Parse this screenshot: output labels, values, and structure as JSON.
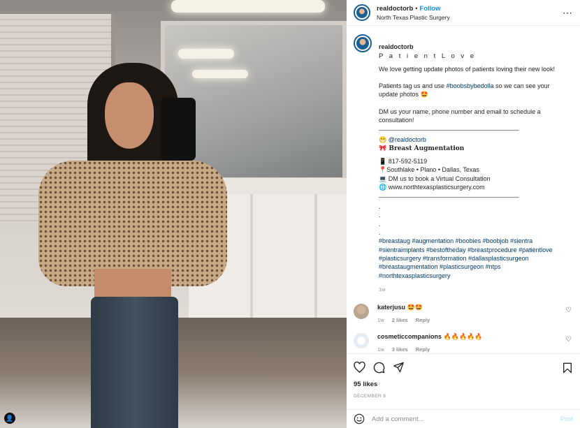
{
  "header": {
    "username": "realdoctorb",
    "separator": "•",
    "follow_label": "Follow",
    "location": "North Texas Plastic Surgery",
    "more_icon": "more-icon"
  },
  "caption": {
    "author": "realdoctorb",
    "title": "P a t i e n t  L o v e",
    "line1": "We love getting update photos of patients loving their new look!",
    "line2_pre": "Patients tag us and use ",
    "line2_tag": "#boobsbybedolla",
    "line2_post": " so we can see your update photos 🤩",
    "line3": "DM us your name, phone number and email to schedule a consultation!",
    "divider1": "________________________________________",
    "mention_prefix": "😁 ",
    "mention": "@realdoctorb",
    "service": "🎀 Breast Augmentation",
    "phone": "📱 817-592-5119",
    "locations": "📍Southlake • Plano • Dallas, Texas",
    "virtual": "💻 DM us to book a Virtual Consultation",
    "website": "🌐 www.northtexasplasticsurgery.com",
    "divider2": "________________________________________",
    "dots": ".\n.\n.\n.",
    "hashtags": "#breastaug #augmentation #boobies #boobjob #sientra #sientraimplants #bestoftheday #breastprocedure #patientlove #plasticsurgery #transformation #dallasplasticsurgeon #breastaugmentation #plasticsurgeon #ntps #northtexasplasticsurgery",
    "time": "1w"
  },
  "comments": [
    {
      "user": "katerjusu",
      "text": "🤩🤩",
      "time": "1w",
      "likes": "2 likes",
      "reply": "Reply"
    },
    {
      "user": "cosmeticcompanions",
      "text": "🔥🔥🔥🔥🔥",
      "time": "1w",
      "likes": "3 likes",
      "reply": "Reply"
    }
  ],
  "actions": {
    "likes": "95 likes",
    "date": "DECEMBER 8"
  },
  "add_comment": {
    "placeholder": "Add a comment...",
    "post_label": "Post"
  },
  "colors": {
    "link_blue": "#0095f6",
    "tag_blue": "#00376b",
    "muted": "#8e8e8e",
    "post_disabled": "#b2dffc"
  }
}
